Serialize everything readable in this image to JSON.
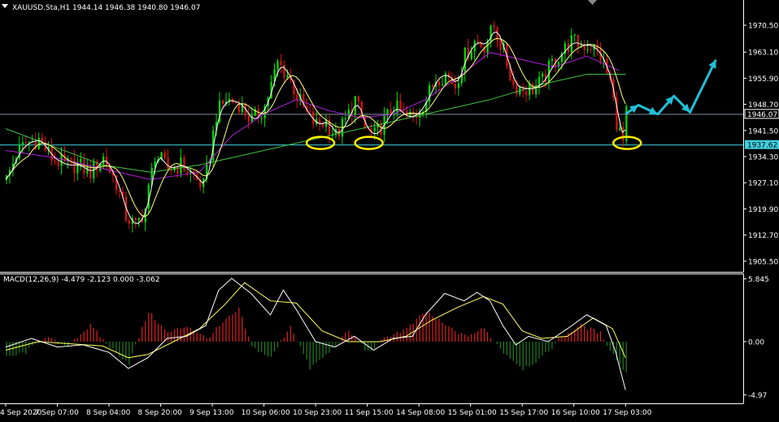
{
  "header": {
    "symbol_info": "XAUUSD.Sta,H1  1944.14 1946.38 1940.80 1946.07",
    "macd_info": "MACD(12,26,9) -4.479 -2.123 0.000 -3.062"
  },
  "price_tags": {
    "current": "1946.07",
    "level": "1937.62"
  },
  "colors": {
    "background": "#000000",
    "bull_candle": "#00e000",
    "bear_candle": "#e01010",
    "ma_fast": "#ffffff",
    "ma_mid": "#ffff80",
    "ma_slow": "#b020e0",
    "ma_long": "#40c040",
    "hline": "#40d0e0",
    "arrow": "#20c0d8",
    "ellipse": "#ffee00",
    "macd_line": "#ffffff",
    "signal_line": "#ffff60",
    "hist_pos": "#e02020",
    "hist_neg": "#208020",
    "axis": "#ffffff"
  },
  "icons": {
    "menu": "triangle-down-icon"
  },
  "chart_data": [
    {
      "type": "candlestick",
      "symbol": "XAUUSD.Sta",
      "timeframe": "H1",
      "ylim": [
        1903.0,
        1977.0
      ],
      "y_ticks": [
        "1970.50",
        "1963.10",
        "1955.90",
        "1948.70",
        "1941.50",
        "1934.30",
        "1927.10",
        "1919.90",
        "1912.70",
        "1905.50"
      ],
      "y_tick_values": [
        1970.5,
        1963.1,
        1955.9,
        1948.7,
        1941.5,
        1934.3,
        1927.1,
        1919.9,
        1912.7,
        1905.5
      ],
      "x_ticks": [
        "4 Sep 2020",
        "7 Sep 07:00",
        "8 Sep 04:00",
        "8 Sep 20:00",
        "9 Sep 13:00",
        "10 Sep 06:00",
        "10 Sep 23:00",
        "11 Sep 15:00",
        "14 Sep 08:00",
        "15 Sep 01:00",
        "15 Sep 17:00",
        "16 Sep 10:00",
        "17 Sep 03:00"
      ],
      "x_tick_bar": [
        0,
        16,
        32,
        48,
        64,
        80,
        96,
        112,
        128,
        144,
        160,
        176,
        192
      ],
      "close_path": [
        [
          0,
          1928
        ],
        [
          3,
          1935
        ],
        [
          6,
          1938
        ],
        [
          10,
          1939
        ],
        [
          14,
          1934
        ],
        [
          18,
          1932
        ],
        [
          22,
          1932
        ],
        [
          26,
          1930
        ],
        [
          30,
          1934
        ],
        [
          34,
          1927
        ],
        [
          37,
          1918
        ],
        [
          40,
          1915
        ],
        [
          43,
          1920
        ],
        [
          46,
          1935
        ],
        [
          50,
          1931
        ],
        [
          54,
          1932
        ],
        [
          58,
          1929
        ],
        [
          61,
          1926
        ],
        [
          63,
          1935
        ],
        [
          65,
          1946
        ],
        [
          68,
          1950
        ],
        [
          72,
          1949
        ],
        [
          76,
          1944
        ],
        [
          80,
          1948
        ],
        [
          84,
          1960
        ],
        [
          87,
          1957
        ],
        [
          90,
          1951
        ],
        [
          93,
          1946
        ],
        [
          96,
          1943
        ],
        [
          99,
          1944
        ],
        [
          102,
          1940
        ],
        [
          105,
          1944
        ],
        [
          108,
          1950
        ],
        [
          111,
          1942
        ],
        [
          114,
          1940
        ],
        [
          117,
          1944
        ],
        [
          120,
          1948
        ],
        [
          124,
          1945
        ],
        [
          127,
          1946
        ],
        [
          130,
          1950
        ],
        [
          133,
          1956
        ],
        [
          136,
          1957
        ],
        [
          139,
          1954
        ],
        [
          142,
          1962
        ],
        [
          145,
          1966
        ],
        [
          148,
          1965
        ],
        [
          151,
          1970
        ],
        [
          154,
          1963
        ],
        [
          157,
          1954
        ],
        [
          160,
          1953
        ],
        [
          163,
          1953
        ],
        [
          166,
          1955
        ],
        [
          169,
          1960
        ],
        [
          172,
          1963
        ],
        [
          175,
          1966
        ],
        [
          178,
          1965
        ],
        [
          181,
          1965
        ],
        [
          184,
          1962
        ],
        [
          187,
          1955
        ],
        [
          189,
          1944
        ],
        [
          191,
          1938
        ],
        [
          192,
          1946
        ]
      ],
      "moving_averages": [
        {
          "color_key": "ma_long",
          "path": [
            [
              0,
              1942
            ],
            [
              15,
              1937
            ],
            [
              30,
              1932
            ],
            [
              45,
              1930
            ],
            [
              60,
              1932
            ],
            [
              75,
              1935
            ],
            [
              90,
              1938
            ],
            [
              105,
              1941
            ],
            [
              120,
              1944
            ],
            [
              135,
              1947
            ],
            [
              150,
              1950
            ],
            [
              165,
              1954
            ],
            [
              180,
              1957
            ],
            [
              192,
              1957
            ]
          ]
        },
        {
          "color_key": "ma_slow",
          "path": [
            [
              0,
              1936
            ],
            [
              15,
              1934
            ],
            [
              30,
              1931
            ],
            [
              45,
              1928
            ],
            [
              60,
              1930
            ],
            [
              70,
              1940
            ],
            [
              80,
              1946
            ],
            [
              90,
              1950
            ],
            [
              100,
              1947
            ],
            [
              110,
              1945
            ],
            [
              120,
              1946
            ],
            [
              130,
              1950
            ],
            [
              140,
              1956
            ],
            [
              150,
              1963
            ],
            [
              160,
              1961
            ],
            [
              170,
              1959
            ],
            [
              180,
              1962
            ],
            [
              190,
              1958
            ]
          ]
        }
      ],
      "horizontal_levels": [
        1946.07,
        1937.62
      ],
      "highlight_bars": [
        97,
        112,
        192
      ],
      "projection_path": [
        [
          192,
          1946
        ],
        [
          196,
          1948.5
        ],
        [
          202,
          1946
        ],
        [
          207,
          1951
        ],
        [
          212,
          1946.5
        ],
        [
          220,
          1961
        ]
      ]
    },
    {
      "type": "macd",
      "params": "12,26,9",
      "ylim": [
        -5.6,
        6.2
      ],
      "y_ticks": [
        "5.845",
        "0.00",
        "-4.97"
      ],
      "y_tick_values": [
        5.845,
        0.0,
        -4.97
      ],
      "macd_path": [
        [
          0,
          -0.5
        ],
        [
          8,
          0.3
        ],
        [
          16,
          -0.5
        ],
        [
          24,
          -0.3
        ],
        [
          32,
          -1.0
        ],
        [
          38,
          -2.5
        ],
        [
          44,
          -1.5
        ],
        [
          50,
          0.3
        ],
        [
          56,
          0.5
        ],
        [
          62,
          1.5
        ],
        [
          66,
          4.8
        ],
        [
          70,
          5.9
        ],
        [
          76,
          4.5
        ],
        [
          82,
          2.5
        ],
        [
          86,
          4.8
        ],
        [
          90,
          3.0
        ],
        [
          96,
          0.0
        ],
        [
          102,
          -0.5
        ],
        [
          108,
          0.5
        ],
        [
          114,
          -0.8
        ],
        [
          120,
          0.3
        ],
        [
          126,
          0.5
        ],
        [
          130,
          2.5
        ],
        [
          136,
          4.5
        ],
        [
          142,
          3.8
        ],
        [
          146,
          4.6
        ],
        [
          150,
          3.8
        ],
        [
          154,
          1.5
        ],
        [
          158,
          -0.3
        ],
        [
          162,
          0.5
        ],
        [
          168,
          0.0
        ],
        [
          174,
          1.2
        ],
        [
          180,
          2.5
        ],
        [
          186,
          1.5
        ],
        [
          189,
          -1.0
        ],
        [
          192,
          -4.5
        ]
      ],
      "signal_path": [
        [
          0,
          -0.8
        ],
        [
          10,
          0.0
        ],
        [
          20,
          -0.2
        ],
        [
          30,
          -0.4
        ],
        [
          38,
          -1.5
        ],
        [
          44,
          -1.2
        ],
        [
          52,
          0.0
        ],
        [
          60,
          1.2
        ],
        [
          68,
          3.5
        ],
        [
          74,
          5.5
        ],
        [
          82,
          3.8
        ],
        [
          90,
          3.6
        ],
        [
          98,
          1.0
        ],
        [
          106,
          0.0
        ],
        [
          116,
          0.0
        ],
        [
          124,
          0.5
        ],
        [
          132,
          2.0
        ],
        [
          140,
          3.2
        ],
        [
          148,
          4.2
        ],
        [
          154,
          3.5
        ],
        [
          160,
          1.0
        ],
        [
          166,
          0.3
        ],
        [
          174,
          0.5
        ],
        [
          182,
          2.2
        ],
        [
          188,
          1.2
        ],
        [
          192,
          -1.5
        ]
      ],
      "histogram_path": [
        [
          0,
          -1.5
        ],
        [
          6,
          -1.0
        ],
        [
          12,
          0.5
        ],
        [
          18,
          -0.5
        ],
        [
          26,
          1.5
        ],
        [
          32,
          -0.5
        ],
        [
          38,
          -2.0
        ],
        [
          44,
          2.8
        ],
        [
          50,
          0.8
        ],
        [
          56,
          1.5
        ],
        [
          62,
          0.3
        ],
        [
          68,
          2.0
        ],
        [
          72,
          3.0
        ],
        [
          76,
          -0.5
        ],
        [
          82,
          -1.5
        ],
        [
          88,
          1.5
        ],
        [
          94,
          -2.5
        ],
        [
          100,
          -1.0
        ],
        [
          106,
          1.0
        ],
        [
          112,
          -1.0
        ],
        [
          118,
          0.5
        ],
        [
          124,
          1.2
        ],
        [
          130,
          2.8
        ],
        [
          136,
          1.5
        ],
        [
          142,
          0.5
        ],
        [
          148,
          1.2
        ],
        [
          154,
          -1.0
        ],
        [
          160,
          -2.5
        ],
        [
          166,
          -1.5
        ],
        [
          172,
          0.5
        ],
        [
          178,
          1.5
        ],
        [
          184,
          0.8
        ],
        [
          188,
          -1.2
        ],
        [
          192,
          -3.0
        ]
      ]
    }
  ]
}
